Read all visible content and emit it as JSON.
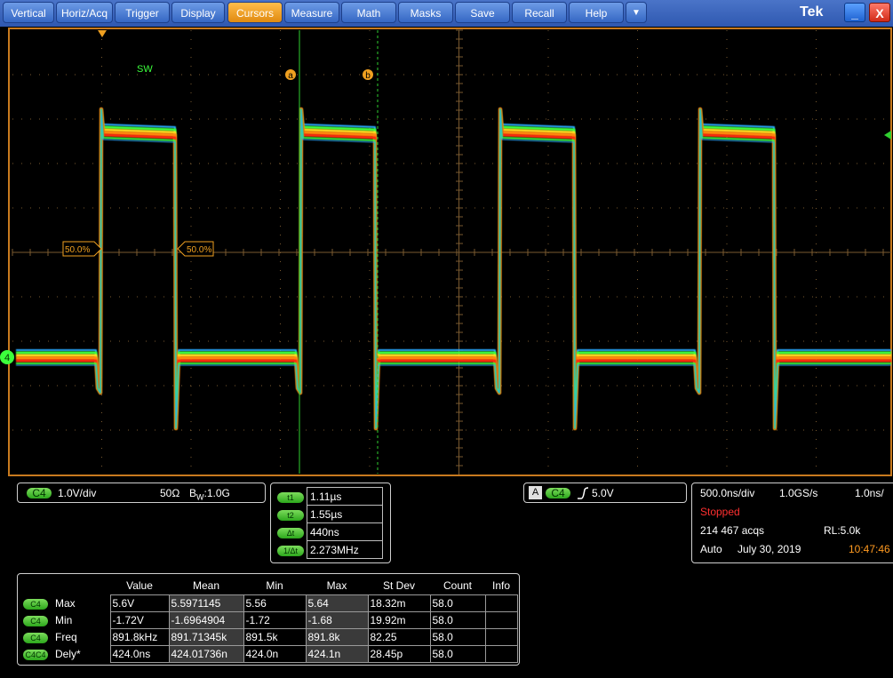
{
  "menu": {
    "items": [
      "Vertical",
      "Horiz/Acq",
      "Trigger",
      "Display",
      "Cursors",
      "Measure",
      "Math",
      "Masks",
      "Save",
      "Recall",
      "Help"
    ],
    "active": "Cursors",
    "more": "▼",
    "brand": "Tek",
    "minimize": "_",
    "close": "X"
  },
  "display": {
    "trace_label": "SW",
    "cursor_a": "a",
    "cursor_b": "b",
    "ref_left": "50.0%",
    "ref_right": "50.0%",
    "channel_marker": "4"
  },
  "channel": {
    "badge": "C4",
    "scale": "1.0V/div",
    "impedance": "50Ω",
    "bw_prefix": "B",
    "bw_sub": "W",
    "bw_value": ":1.0G"
  },
  "cursors": {
    "rows": [
      {
        "label": "t1",
        "value": "1.11µs"
      },
      {
        "label": "t2",
        "value": "1.55µs"
      },
      {
        "label": "Δt",
        "value": "440ns"
      },
      {
        "label": "1/Δt",
        "value": "2.273MHz"
      }
    ]
  },
  "trigger": {
    "mode_badge": "A",
    "source": "C4",
    "slope_icon": "rising-edge",
    "level": "5.0V"
  },
  "acquisition": {
    "timebase": "500.0ns/div",
    "sample_rate": "1.0GS/s",
    "resolution": "1.0ns/",
    "status": "Stopped",
    "acqs": "214 467 acqs",
    "record_length": "RL:5.0k",
    "mode": "Auto",
    "date": "July 30, 2019",
    "time": "10:47:46"
  },
  "measurements": {
    "headers": [
      "Value",
      "Mean",
      "Min",
      "Max",
      "St Dev",
      "Count",
      "Info"
    ],
    "rows": [
      {
        "source": "C4",
        "name": "Max",
        "cells": [
          "5.6V",
          "5.5971145",
          "5.56",
          "5.64",
          "18.32m",
          "58.0",
          ""
        ]
      },
      {
        "source": "C4",
        "name": "Min",
        "cells": [
          "-1.72V",
          "-1.6964904",
          "-1.72",
          "-1.68",
          "19.92m",
          "58.0",
          ""
        ]
      },
      {
        "source": "C4",
        "name": "Freq",
        "cells": [
          "891.8kHz",
          "891.71345k",
          "891.5k",
          "891.8k",
          "82.25",
          "58.0",
          ""
        ]
      },
      {
        "source": "C4C4",
        "name": "Dely*",
        "cells": [
          "424.0ns",
          "424.01736n",
          "424.0n",
          "424.1n",
          "28.45p",
          "58.0",
          ""
        ]
      }
    ]
  },
  "colors": {
    "accent": "#f0a020",
    "menu": "#3567c4",
    "trace_green": "#3cff3c",
    "status_red": "#ff3030",
    "time_orange": "#ff9a20"
  }
}
